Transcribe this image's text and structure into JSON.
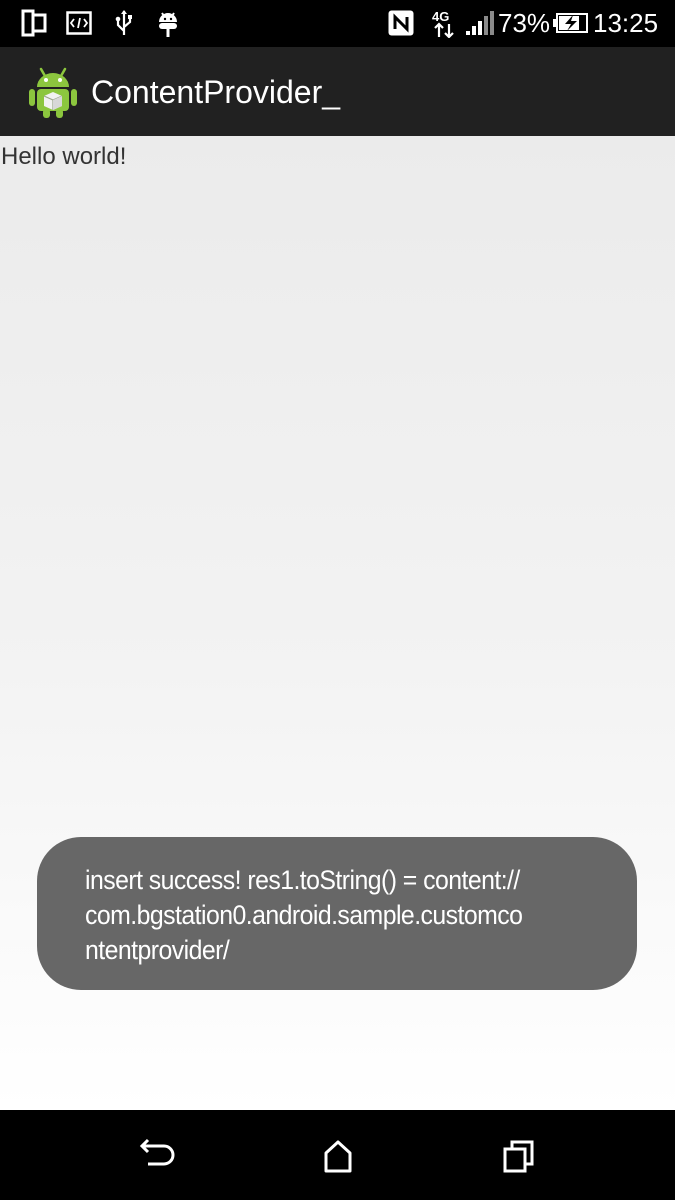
{
  "status_bar": {
    "left_icons": [
      "tablet-icon",
      "code-icon",
      "usb-icon",
      "debug-android-icon"
    ],
    "right_icons": [
      "nfc-icon",
      "network-4g-icon",
      "signal-icon",
      "battery-charging-icon"
    ],
    "battery_percent": "73%",
    "time": "13:25"
  },
  "action_bar": {
    "app_icon": "android-app-icon",
    "title": "ContentProvider_"
  },
  "content": {
    "text": "Hello world!"
  },
  "toast": {
    "lines": [
      "insert success! res1.toString() = content://",
      "com.bgstation0.android.sample.customco",
      "ntentprovider/"
    ]
  },
  "nav_bar": {
    "buttons": [
      "back-icon",
      "home-icon",
      "recents-icon"
    ]
  },
  "colors": {
    "status_bar": "#000000",
    "action_bar": "#212121",
    "toast": "#676767",
    "android_green": "#8cc63e"
  }
}
